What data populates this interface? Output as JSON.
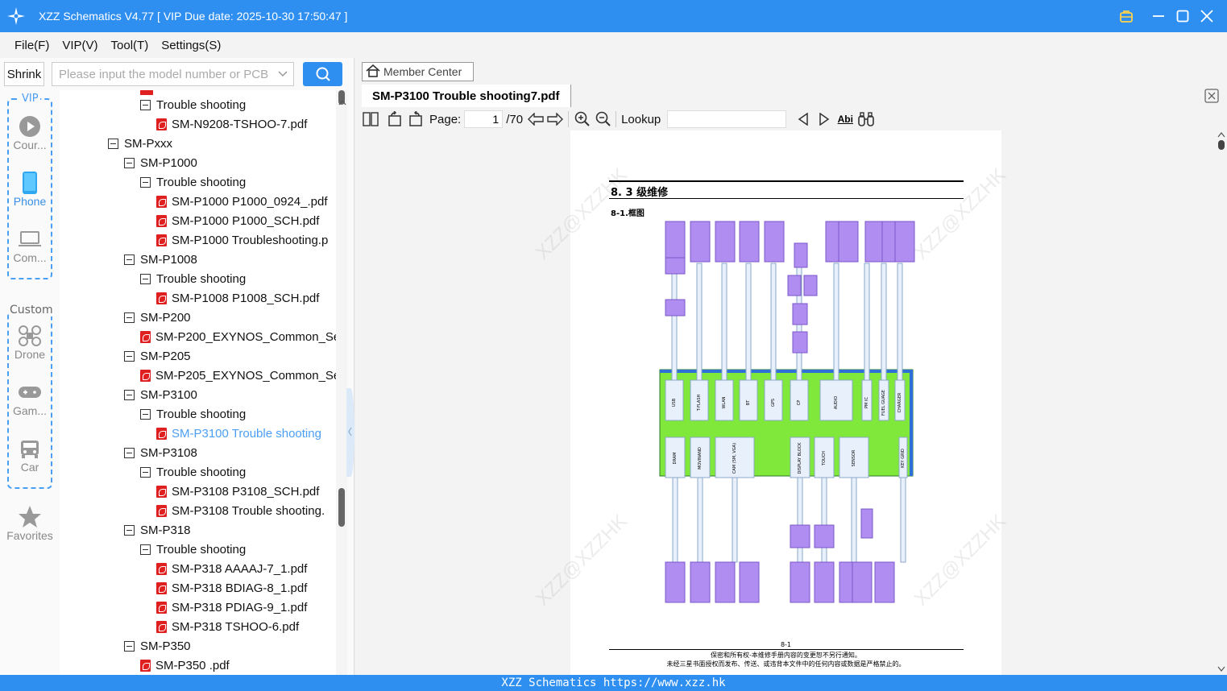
{
  "app": {
    "title": "XZZ Schematics V4.77  [ VIP Due date: 2025-10-30 17:50:47 ]"
  },
  "menu": [
    "File(F)",
    "VIP(V)",
    "Tool(T)",
    "Settings(S)"
  ],
  "search": {
    "shrink_label": "Shrink",
    "placeholder": "Please input the model number or PCB"
  },
  "categories": {
    "vip_label": "VIP",
    "custom_label": "Custom",
    "items": [
      "Cour...",
      "Phone",
      "Com...",
      "Drone",
      "Gam...",
      "Car",
      "Favorites"
    ]
  },
  "tree": [
    {
      "label": "Trouble shooting",
      "type": "folder",
      "level": 2
    },
    {
      "label": "SM-N9208-TSHOO-7.pdf",
      "type": "pdf",
      "level": 3
    },
    {
      "label": "SM-Pxxx",
      "type": "folder",
      "level": 0
    },
    {
      "label": "SM-P1000",
      "type": "folder",
      "level": 1
    },
    {
      "label": "Trouble shooting",
      "type": "folder",
      "level": 2
    },
    {
      "label": "SM-P1000 P1000_0924_.pdf",
      "type": "pdf",
      "level": 3
    },
    {
      "label": "SM-P1000 P1000_SCH.pdf",
      "type": "pdf",
      "level": 3
    },
    {
      "label": "SM-P1000 Troubleshooting.p",
      "type": "pdf",
      "level": 3
    },
    {
      "label": "SM-P1008",
      "type": "folder",
      "level": 1
    },
    {
      "label": "Trouble shooting",
      "type": "folder",
      "level": 2
    },
    {
      "label": "SM-P1008 P1008_SCH.pdf",
      "type": "pdf",
      "level": 3
    },
    {
      "label": "SM-P200",
      "type": "folder",
      "level": 1
    },
    {
      "label": "SM-P200_EXYNOS_Common_Se",
      "type": "pdf",
      "level": 2
    },
    {
      "label": "SM-P205",
      "type": "folder",
      "level": 1
    },
    {
      "label": "SM-P205_EXYNOS_Common_Se",
      "type": "pdf",
      "level": 2
    },
    {
      "label": "SM-P3100",
      "type": "folder",
      "level": 1
    },
    {
      "label": "Trouble shooting",
      "type": "folder",
      "level": 2
    },
    {
      "label": "SM-P3100 Trouble shooting",
      "type": "pdf",
      "level": 3,
      "selected": true
    },
    {
      "label": "SM-P3108",
      "type": "folder",
      "level": 1
    },
    {
      "label": "Trouble shooting",
      "type": "folder",
      "level": 2
    },
    {
      "label": "SM-P3108 P3108_SCH.pdf",
      "type": "pdf",
      "level": 3
    },
    {
      "label": "SM-P3108 Trouble shooting.",
      "type": "pdf",
      "level": 3
    },
    {
      "label": "SM-P318",
      "type": "folder",
      "level": 1
    },
    {
      "label": "Trouble shooting",
      "type": "folder",
      "level": 2
    },
    {
      "label": "SM-P318 AAAAJ-7_1.pdf",
      "type": "pdf",
      "level": 3
    },
    {
      "label": "SM-P318 BDIAG-8_1.pdf",
      "type": "pdf",
      "level": 3
    },
    {
      "label": "SM-P318 PDIAG-9_1.pdf",
      "type": "pdf",
      "level": 3
    },
    {
      "label": "SM-P318 TSHOO-6.pdf",
      "type": "pdf",
      "level": 3
    },
    {
      "label": "SM-P350",
      "type": "folder",
      "level": 1
    },
    {
      "label": "SM-P350 .pdf",
      "type": "pdf",
      "level": 2
    }
  ],
  "viewer": {
    "member_center": "Member Center",
    "tab_title": "SM-P3100 Trouble shooting7.pdf",
    "page_label": "Page:",
    "page_current": "1",
    "page_total": "/70",
    "lookup_label": "Lookup",
    "abi_label": "Abi"
  },
  "document": {
    "heading": "8. 3 级维修",
    "subheading": "8-1.框图",
    "page_number": "8-1",
    "footer_line1": "保密和所有权-本维修手册内容的变更恕不另行通知。",
    "footer_line2": "未经三星书面授权而发布、传送、或违背本文件中的任何内容或数据是严格禁止的。",
    "watermark": "XZZ@XZZHK",
    "top_row_blocks": [
      "USB",
      "T-FLASH",
      "WLAN",
      "BT",
      "GPS",
      "CP",
      "AUDIO",
      "PM IC",
      "FUEL GUAGE",
      "CHARGER"
    ],
    "bottom_row_blocks": [
      "DRAM",
      "MOVINAND",
      "CAM (5M, VGA)",
      "DISPLAY BLOCK",
      "TOUCH",
      "SENSOR",
      "KEY GRID"
    ]
  },
  "status": {
    "text": "XZZ Schematics https://www.xzz.hk"
  },
  "colors": {
    "accent": "#2f8ff0",
    "selected_text": "#4a9ff5",
    "board_green": "#7fe83a",
    "block_purple": "#b08df0",
    "pdf_red": "#e02020"
  }
}
